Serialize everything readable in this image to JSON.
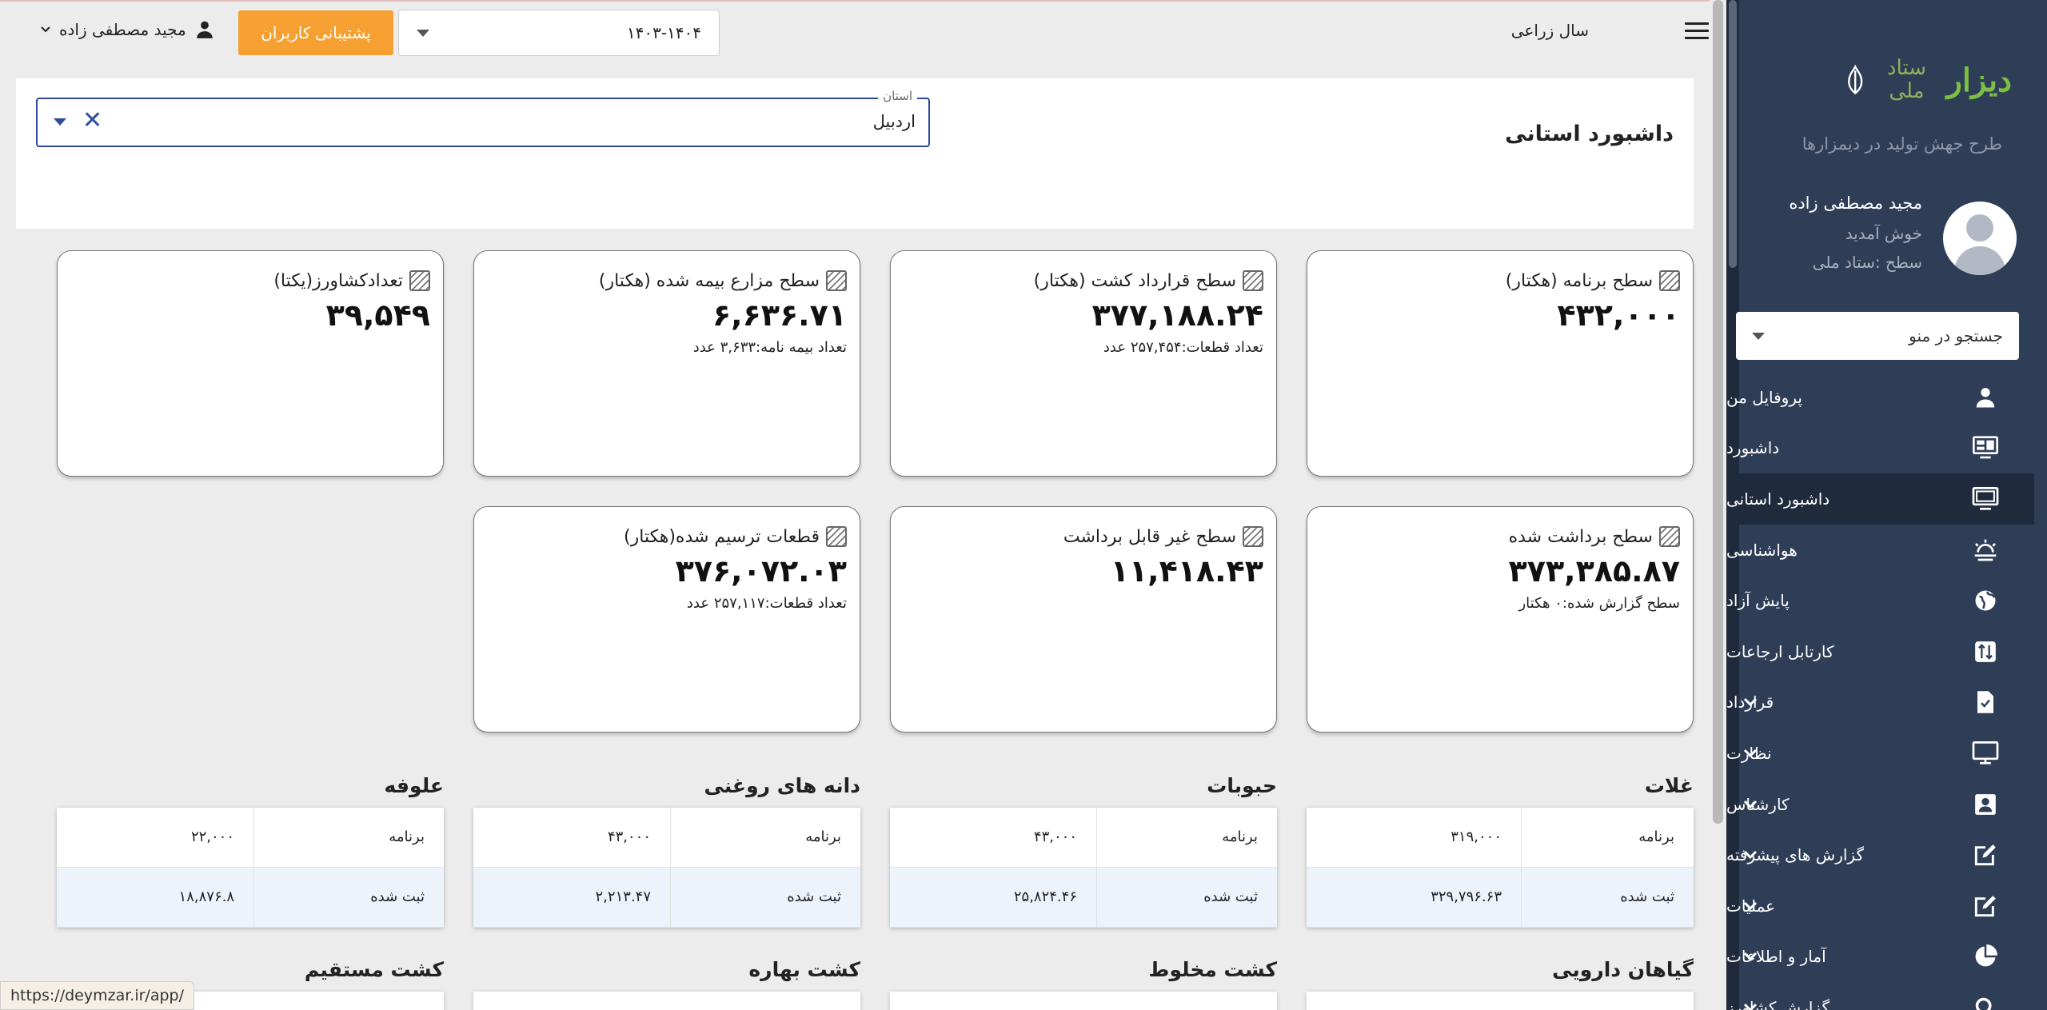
{
  "sidebar": {
    "logo_text": "دیزار",
    "logo_emblem": "ستاد ملی",
    "subtitle": "طرح جهش تولید در دیمزارها",
    "user_name": "مجید مصطفی زاده",
    "welcome": "خوش آمدید",
    "level": "سطح :ستاد ملی",
    "search_placeholder": "جستجو در منو",
    "items": [
      {
        "label": "پروفایل من",
        "icon": "person-icon",
        "has_submenu": false
      },
      {
        "label": "داشبورد",
        "icon": "dashboard-icon",
        "has_submenu": false
      },
      {
        "label": "داشبورد استانی",
        "icon": "monitor-icon",
        "has_submenu": false,
        "active": true
      },
      {
        "label": "هواشناسی",
        "icon": "weather-icon",
        "has_submenu": false
      },
      {
        "label": "پایش آزاد",
        "icon": "globe-icon",
        "has_submenu": false
      },
      {
        "label": "کارتابل ارجاعات",
        "icon": "referral-icon",
        "has_submenu": false
      },
      {
        "label": "قرارداد",
        "icon": "contract-icon",
        "has_submenu": true
      },
      {
        "label": "نظارت",
        "icon": "supervision-icon",
        "has_submenu": true
      },
      {
        "label": "کارشناس",
        "icon": "expert-icon",
        "has_submenu": true
      },
      {
        "label": "گزارش های پیشرفته",
        "icon": "edit-report-icon",
        "has_submenu": true
      },
      {
        "label": "عملیات",
        "icon": "operations-icon",
        "has_submenu": true
      },
      {
        "label": "آمار و اطلاعات",
        "icon": "pie-chart-icon",
        "has_submenu": true
      },
      {
        "label": "گزارش کشاورز",
        "icon": "search-icon",
        "has_submenu": true
      }
    ]
  },
  "topbar": {
    "year_label": "سال زراعی",
    "year_value": "۱۴۰۳-۱۴۰۴",
    "support_label": "پشتیبانی کاربران",
    "user_name": "مجید مصطفی زاده"
  },
  "main": {
    "page_title": "داشبورد استانی",
    "province_label": "استان",
    "province_value": "اردبیل",
    "cards": [
      {
        "title": "سطح برنامه (هکتار)",
        "value": "۴۳۲,۰۰۰",
        "sub": ""
      },
      {
        "title": "سطح قرارداد کشت (هکتار)",
        "value": "۳۷۷,۱۸۸.۲۴",
        "sub": "تعداد قطعات:۲۵۷,۴۵۴ عدد"
      },
      {
        "title": "سطح مزارع بیمه شده (هکتار)",
        "value": "۶,۶۳۶.۷۱",
        "sub": "تعداد بیمه نامه:۳,۶۳۳ عدد"
      },
      {
        "title": "تعدادکشاورز(یکتا)",
        "value": "۳۹,۵۴۹",
        "sub": ""
      },
      {
        "title": "سطح برداشت شده",
        "value": "۳۷۳,۳۸۵.۸۷",
        "sub": "سطح گزارش شده:۰ هکتار"
      },
      {
        "title": "سطح غیر قابل برداشت",
        "value": "۱۱,۴۱۸.۴۳",
        "sub": ""
      },
      {
        "title": "قطعات ترسیم شده(هکتار)",
        "value": "۳۷۶,۰۷۲.۰۳",
        "sub": "تعداد قطعات:۲۵۷,۱۱۷ عدد"
      }
    ],
    "crop_tables": [
      {
        "title": "غلات",
        "rows": [
          {
            "label": "برنامه",
            "value": "۳۱۹,۰۰۰"
          },
          {
            "label": "ثبت شده",
            "value": "۳۲۹,۷۹۶.۶۳"
          }
        ]
      },
      {
        "title": "حبوبات",
        "rows": [
          {
            "label": "برنامه",
            "value": "۴۳,۰۰۰"
          },
          {
            "label": "ثبت شده",
            "value": "۲۵,۸۲۴.۴۶"
          }
        ]
      },
      {
        "title": "دانه های روغنی",
        "rows": [
          {
            "label": "برنامه",
            "value": "۴۳,۰۰۰"
          },
          {
            "label": "ثبت شده",
            "value": "۲,۲۱۳.۴۷"
          }
        ]
      },
      {
        "title": "علوفه",
        "rows": [
          {
            "label": "برنامه",
            "value": "۲۲,۰۰۰"
          },
          {
            "label": "ثبت شده",
            "value": "۱۸,۸۷۶.۸"
          }
        ]
      }
    ],
    "next_sections": [
      "گیاهان دارویی",
      "کشت مخلوط",
      "کشت بهاره",
      "کشت مستقیم"
    ]
  },
  "status_bar": {
    "url": "https://deymzar.ir/app/"
  }
}
